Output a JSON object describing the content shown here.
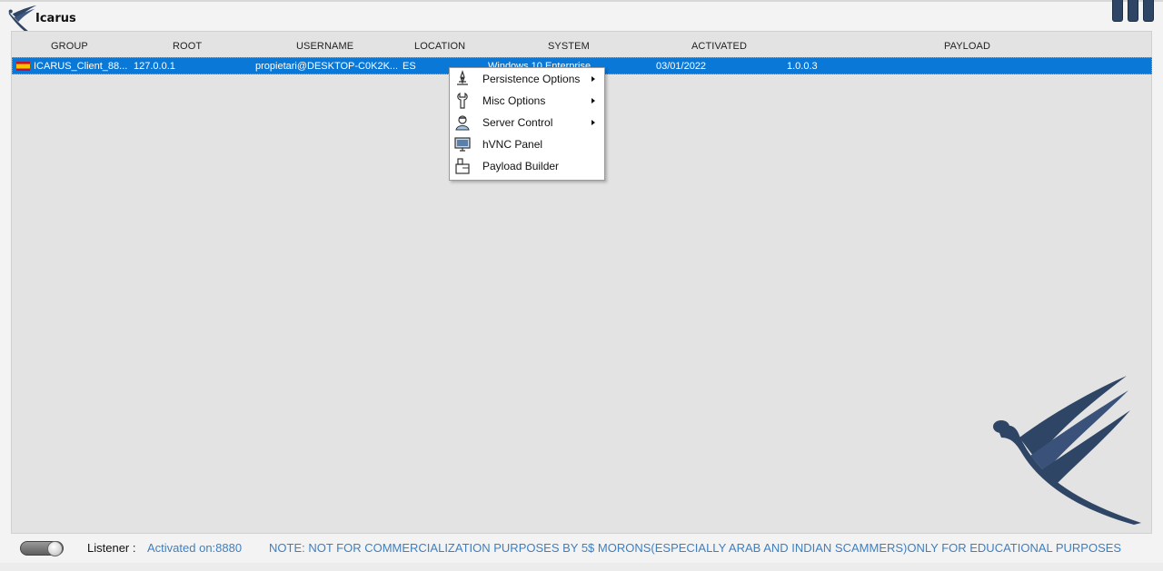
{
  "app": {
    "title": "Icarus"
  },
  "table": {
    "columns": [
      "GROUP",
      "ROOT",
      "USERNAME",
      "LOCATION",
      "SYSTEM",
      "ACTIVATED",
      "PAYLOAD"
    ],
    "rows": [
      {
        "flag": "spain-flag-icon",
        "group": "ICARUS_Client_88...",
        "root": "127.0.0.1",
        "username": "propietari@DESKTOP-C0K2K...",
        "location": "ES",
        "system": "Windows 10 Enterprise",
        "activated": "03/01/2022",
        "payload": "1.0.0.3"
      }
    ]
  },
  "context_menu": {
    "items": [
      {
        "label": "Persistence Options",
        "icon": "persistence-icon",
        "has_submenu": true
      },
      {
        "label": "Misc Options",
        "icon": "tools-icon",
        "has_submenu": true
      },
      {
        "label": "Server Control",
        "icon": "server-user-icon",
        "has_submenu": true
      },
      {
        "label": "hVNC Panel",
        "icon": "monitor-icon",
        "has_submenu": false
      },
      {
        "label": "Payload Builder",
        "icon": "builder-icon",
        "has_submenu": false
      }
    ]
  },
  "status": {
    "listener_label": "Listener :",
    "listener_value": "Activated on:8880",
    "note": "NOTE: NOT FOR COMMERCIALIZATION PURPOSES BY 5$ MORONS(ESPECIALLY ARAB AND INDIAN SCAMMERS)ONLY FOR EDUCATIONAL PURPOSES",
    "toggle_on": true
  },
  "colors": {
    "selection": "#0a78d7",
    "accent": "#2f4565",
    "status_text": "#3f7fbf"
  }
}
